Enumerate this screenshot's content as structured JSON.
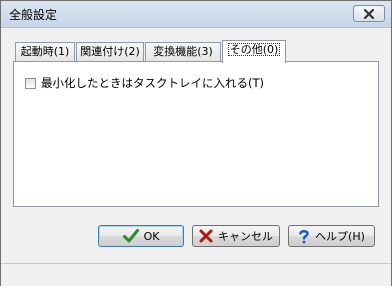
{
  "window": {
    "title": "全般設定"
  },
  "titlebar": {
    "close_icon": "close-icon"
  },
  "tabs": [
    {
      "label": "起動時(1)"
    },
    {
      "label": "関連付け(2)"
    },
    {
      "label": "変換機能(3)"
    },
    {
      "label": "その他(0)",
      "active": true
    }
  ],
  "panel": {
    "minimize_to_tray": {
      "label": "最小化したときはタスクトレイに入れる(T)",
      "checked": false
    }
  },
  "buttons": {
    "ok": {
      "label": "OK",
      "icon": "checkmark-icon",
      "icon_color": "#2e8b2e"
    },
    "cancel": {
      "label": "キャンセル",
      "icon": "x-icon",
      "icon_color": "#b01818"
    },
    "help": {
      "label": "ヘルプ(H)",
      "icon": "question-icon",
      "icon_color": "#1a56c8"
    }
  }
}
